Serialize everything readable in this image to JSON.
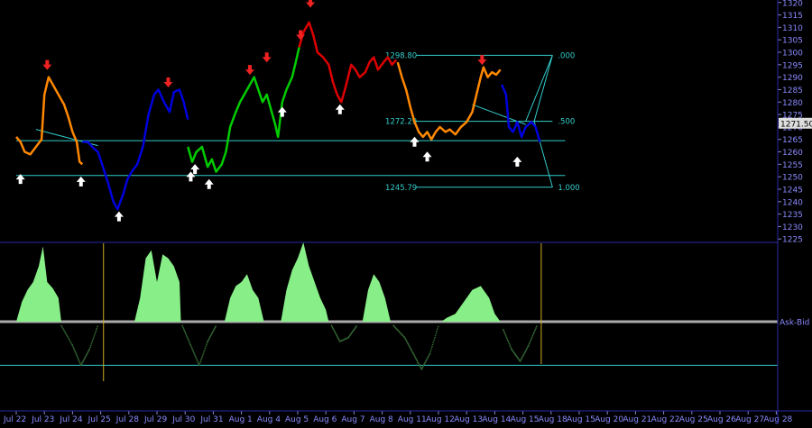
{
  "chart_data": [
    {
      "type": "line",
      "panel": "price",
      "title": "",
      "xlabel": "",
      "ylabel": "",
      "ylim": [
        1224,
        1321
      ],
      "grid": false,
      "legend": "none",
      "x_ticks": [
        "Jul 22",
        "Jul 23",
        "Jul 24",
        "Jul 25",
        "Jul 28",
        "Jul 29",
        "Jul 30",
        "Jul 31",
        "Aug 1",
        "Aug 4",
        "Aug 5",
        "Aug 6",
        "Aug 7",
        "Aug 8",
        "Aug 11",
        "Aug 12",
        "Aug 13",
        "Aug 14",
        "Aug 15",
        "Aug 18",
        "Aug 19",
        "Aug 20",
        "Aug 21",
        "Aug 22",
        "Aug 25",
        "Aug 26",
        "Aug 27",
        "Aug 28"
      ],
      "x_tick_labels": [
        "Jul 22",
        "Jul 23",
        "Jul 24",
        "Jul 25",
        "Jul 28",
        "Jul 29",
        "Jul 30",
        "Jul 31",
        "Aug 1",
        "Aug 4",
        "Aug 5",
        "Aug 6",
        "Aug 7",
        "Aug 8",
        "Aug 11",
        "Aug 12",
        "Aug 13",
        "Aug 14",
        "Aug 15",
        "Aug 18",
        "Aug 15",
        "Aug 20",
        "Aug 21",
        "Aug 22",
        "Aug 25",
        "Aug 26",
        "Aug 27",
        "Aug 28"
      ],
      "y_ticks": [
        1225,
        1230,
        1235,
        1240,
        1245,
        1250,
        1255,
        1260,
        1265,
        1270,
        1275,
        1280,
        1285,
        1290,
        1295,
        1300,
        1305,
        1310,
        1315,
        1320
      ],
      "last_price_label": "1271.50",
      "series": [
        {
          "color": "#ff8800",
          "points": [
            [
              0,
              1266
            ],
            [
              0.15,
              1264
            ],
            [
              0.3,
              1260
            ],
            [
              0.5,
              1259
            ],
            [
              0.7,
              1262
            ],
            [
              0.9,
              1265
            ],
            [
              1.0,
              1283
            ],
            [
              1.15,
              1290
            ],
            [
              1.3,
              1287
            ],
            [
              1.5,
              1283
            ],
            [
              1.7,
              1279
            ],
            [
              1.85,
              1274
            ],
            [
              2.0,
              1268
            ],
            [
              2.15,
              1264
            ],
            [
              2.25,
              1256
            ],
            [
              2.35,
              1255
            ]
          ]
        },
        {
          "color": "#0000dd",
          "points": [
            [
              2.35,
              1264
            ],
            [
              2.55,
              1264
            ],
            [
              2.7,
              1262
            ],
            [
              2.9,
              1260
            ],
            [
              3.05,
              1255
            ],
            [
              3.25,
              1248
            ],
            [
              3.45,
              1240
            ],
            [
              3.6,
              1237
            ],
            [
              3.8,
              1243
            ],
            [
              3.95,
              1249
            ],
            [
              4.1,
              1252
            ],
            [
              4.3,
              1255
            ],
            [
              4.5,
              1262
            ],
            [
              4.7,
              1275
            ],
            [
              4.9,
              1283
            ],
            [
              5.05,
              1285
            ],
            [
              5.25,
              1280
            ],
            [
              5.45,
              1276
            ],
            [
              5.6,
              1284
            ],
            [
              5.8,
              1285
            ],
            [
              5.95,
              1280
            ],
            [
              6.1,
              1273
            ]
          ]
        },
        {
          "color": "#00cc00",
          "points": [
            [
              6.1,
              1262
            ],
            [
              6.25,
              1256
            ],
            [
              6.4,
              1260
            ],
            [
              6.6,
              1262
            ],
            [
              6.8,
              1254
            ],
            [
              6.95,
              1257
            ],
            [
              7.1,
              1252
            ],
            [
              7.3,
              1255
            ],
            [
              7.45,
              1260
            ],
            [
              7.6,
              1270
            ],
            [
              7.8,
              1276
            ],
            [
              7.95,
              1280
            ],
            [
              8.1,
              1283
            ],
            [
              8.3,
              1287
            ],
            [
              8.45,
              1290
            ],
            [
              8.6,
              1285
            ],
            [
              8.75,
              1280
            ],
            [
              8.9,
              1283
            ],
            [
              9.05,
              1277
            ],
            [
              9.2,
              1271
            ],
            [
              9.3,
              1266
            ],
            [
              9.45,
              1280
            ],
            [
              9.6,
              1285
            ],
            [
              9.8,
              1290
            ],
            [
              9.95,
              1297
            ],
            [
              10.05,
              1302
            ]
          ]
        },
        {
          "color": "#dd0000",
          "points": [
            [
              10.05,
              1302
            ],
            [
              10.2,
              1308
            ],
            [
              10.4,
              1312
            ],
            [
              10.55,
              1307
            ],
            [
              10.7,
              1300
            ],
            [
              10.9,
              1298
            ],
            [
              11.1,
              1295
            ],
            [
              11.25,
              1288
            ],
            [
              11.4,
              1283
            ],
            [
              11.55,
              1280
            ],
            [
              11.7,
              1286
            ],
            [
              11.9,
              1295
            ],
            [
              12.05,
              1293
            ],
            [
              12.2,
              1290
            ],
            [
              12.4,
              1292
            ],
            [
              12.55,
              1296
            ],
            [
              12.7,
              1298
            ],
            [
              12.85,
              1293
            ],
            [
              13.05,
              1296
            ],
            [
              13.2,
              1298
            ],
            [
              13.35,
              1295
            ],
            [
              13.5,
              1297
            ]
          ]
        },
        {
          "color": "#ff8800",
          "points": [
            [
              13.55,
              1296
            ],
            [
              13.7,
              1290
            ],
            [
              13.85,
              1285
            ],
            [
              14.0,
              1278
            ],
            [
              14.15,
              1272
            ],
            [
              14.3,
              1268
            ],
            [
              14.45,
              1266
            ],
            [
              14.6,
              1268
            ],
            [
              14.75,
              1265
            ],
            [
              14.9,
              1268
            ],
            [
              15.05,
              1270
            ],
            [
              15.25,
              1268
            ],
            [
              15.4,
              1269
            ],
            [
              15.6,
              1267
            ],
            [
              15.8,
              1270
            ],
            [
              16.0,
              1272
            ],
            [
              16.2,
              1276
            ],
            [
              16.35,
              1283
            ],
            [
              16.5,
              1290
            ],
            [
              16.6,
              1294
            ],
            [
              16.75,
              1290
            ],
            [
              16.9,
              1292
            ],
            [
              17.05,
              1291
            ],
            [
              17.2,
              1293
            ]
          ]
        },
        {
          "color": "#0000dd",
          "points": [
            [
              17.25,
              1287
            ],
            [
              17.4,
              1283
            ],
            [
              17.5,
              1270
            ],
            [
              17.65,
              1268
            ],
            [
              17.8,
              1272
            ],
            [
              17.95,
              1266
            ],
            [
              18.1,
              1270
            ],
            [
              18.3,
              1272
            ],
            [
              18.45,
              1270
            ],
            [
              18.6,
              1264
            ]
          ]
        }
      ],
      "arrows": [
        {
          "dir": "down",
          "x": 1.1,
          "y": 1294
        },
        {
          "dir": "down",
          "x": 5.4,
          "y": 1287
        },
        {
          "dir": "down",
          "x": 8.3,
          "y": 1292
        },
        {
          "dir": "down",
          "x": 8.9,
          "y": 1297
        },
        {
          "dir": "down",
          "x": 10.1,
          "y": 1306
        },
        {
          "dir": "down",
          "x": 10.45,
          "y": 1319
        },
        {
          "dir": "down",
          "x": 16.55,
          "y": 1296
        },
        {
          "dir": "up",
          "x": 0.15,
          "y": 1250
        },
        {
          "dir": "up",
          "x": 2.3,
          "y": 1249
        },
        {
          "dir": "up",
          "x": 3.65,
          "y": 1235
        },
        {
          "dir": "up",
          "x": 6.2,
          "y": 1251
        },
        {
          "dir": "up",
          "x": 6.35,
          "y": 1254
        },
        {
          "dir": "up",
          "x": 6.85,
          "y": 1248
        },
        {
          "dir": "up",
          "x": 9.45,
          "y": 1277
        },
        {
          "dir": "up",
          "x": 11.5,
          "y": 1278
        },
        {
          "dir": "up",
          "x": 14.15,
          "y": 1265
        },
        {
          "dir": "up",
          "x": 14.6,
          "y": 1259
        },
        {
          "dir": "up",
          "x": 17.8,
          "y": 1257
        }
      ],
      "horizontal_lines": [
        {
          "y": 1264.5,
          "x_start": 0,
          "x_end": 19.5
        },
        {
          "y": 1250.5,
          "x_start": 0,
          "x_end": 19.5
        }
      ],
      "trendlines": [
        {
          "points": [
            [
              0.7,
              1269
            ],
            [
              2.9,
              1262.5
            ]
          ]
        },
        {
          "points": [
            [
              16.2,
              1279
            ],
            [
              18.1,
              1271
            ]
          ]
        }
      ],
      "fibonacci": {
        "x_start": 14.2,
        "x_end": 19.05,
        "levels": [
          {
            "value": 1298.8,
            "label": "1298.80",
            "ratio": ".000"
          },
          {
            "value": 1272.29,
            "label": "1272.29",
            "ratio": ".500"
          },
          {
            "value": 1245.79,
            "label": "1245.79",
            "ratio": "1.000"
          }
        ],
        "zigzag": [
          [
            18.1,
            1272.29
          ],
          [
            19.05,
            1298.8
          ],
          [
            18.4,
            1272.29
          ],
          [
            19.05,
            1245.79
          ]
        ]
      }
    },
    {
      "type": "area",
      "panel": "indicator",
      "title": "",
      "xlabel": "",
      "ylabel": "",
      "series_label": "Ask-Bid",
      "ylim": [
        -1,
        1
      ],
      "zero_level": 0,
      "lower_level": -0.55,
      "vertical_markers": [
        3.1,
        18.65
      ],
      "series": [
        {
          "color": "#88ee88",
          "points": [
            [
              0,
              0.0
            ],
            [
              0.2,
              0.25
            ],
            [
              0.4,
              0.4
            ],
            [
              0.6,
              0.5
            ],
            [
              0.8,
              0.7
            ],
            [
              0.95,
              0.95
            ],
            [
              1.1,
              0.5
            ],
            [
              1.3,
              0.42
            ],
            [
              1.5,
              0.3
            ],
            [
              1.6,
              0.0
            ]
          ]
        },
        {
          "color": "#88ee88",
          "points": [
            [
              4.2,
              0.0
            ],
            [
              4.4,
              0.3
            ],
            [
              4.6,
              0.8
            ],
            [
              4.8,
              0.9
            ],
            [
              5.0,
              0.5
            ],
            [
              5.2,
              0.85
            ],
            [
              5.4,
              0.8
            ],
            [
              5.6,
              0.7
            ],
            [
              5.8,
              0.5
            ],
            [
              5.85,
              0.0
            ]
          ]
        },
        {
          "color": "#88ee88",
          "points": [
            [
              7.4,
              0.0
            ],
            [
              7.6,
              0.3
            ],
            [
              7.8,
              0.45
            ],
            [
              8.0,
              0.5
            ],
            [
              8.2,
              0.6
            ],
            [
              8.4,
              0.4
            ],
            [
              8.6,
              0.3
            ],
            [
              8.8,
              0.0
            ]
          ]
        },
        {
          "color": "#88ee88",
          "points": [
            [
              9.4,
              0.0
            ],
            [
              9.6,
              0.4
            ],
            [
              9.8,
              0.65
            ],
            [
              10.0,
              0.8
            ],
            [
              10.2,
              1.0
            ],
            [
              10.4,
              0.7
            ],
            [
              10.6,
              0.5
            ],
            [
              10.8,
              0.3
            ],
            [
              11.0,
              0.15
            ],
            [
              11.1,
              0.0
            ]
          ]
        },
        {
          "color": "#88ee88",
          "points": [
            [
              12.3,
              0.0
            ],
            [
              12.5,
              0.4
            ],
            [
              12.7,
              0.6
            ],
            [
              12.9,
              0.5
            ],
            [
              13.1,
              0.3
            ],
            [
              13.3,
              0.0
            ]
          ]
        },
        {
          "color": "#88ee88",
          "points": [
            [
              15.1,
              0.0
            ],
            [
              15.3,
              0.05
            ],
            [
              15.6,
              0.1
            ],
            [
              15.9,
              0.25
            ],
            [
              16.2,
              0.4
            ],
            [
              16.5,
              0.45
            ],
            [
              16.8,
              0.3
            ],
            [
              17.0,
              0.1
            ],
            [
              17.2,
              0.0
            ]
          ]
        },
        {
          "color": "#336633",
          "style": "dots",
          "points": [
            [
              1.6,
              -0.05
            ],
            [
              2.0,
              -0.3
            ],
            [
              2.3,
              -0.55
            ],
            [
              2.6,
              -0.35
            ],
            [
              2.9,
              -0.05
            ]
          ]
        },
        {
          "color": "#336633",
          "style": "dots",
          "points": [
            [
              5.9,
              -0.05
            ],
            [
              6.2,
              -0.3
            ],
            [
              6.5,
              -0.55
            ],
            [
              6.8,
              -0.25
            ],
            [
              7.1,
              -0.05
            ]
          ]
        },
        {
          "color": "#336633",
          "style": "dots",
          "points": [
            [
              11.2,
              -0.05
            ],
            [
              11.5,
              -0.25
            ],
            [
              11.8,
              -0.2
            ],
            [
              12.1,
              -0.05
            ]
          ]
        },
        {
          "color": "#336633",
          "style": "dots",
          "points": [
            [
              13.4,
              -0.05
            ],
            [
              13.8,
              -0.2
            ],
            [
              14.1,
              -0.4
            ],
            [
              14.4,
              -0.6
            ],
            [
              14.7,
              -0.4
            ],
            [
              15.0,
              -0.05
            ]
          ]
        },
        {
          "color": "#336633",
          "style": "dots",
          "points": [
            [
              17.3,
              -0.1
            ],
            [
              17.6,
              -0.35
            ],
            [
              17.9,
              -0.5
            ],
            [
              18.2,
              -0.3
            ],
            [
              18.5,
              -0.05
            ]
          ]
        }
      ]
    }
  ]
}
